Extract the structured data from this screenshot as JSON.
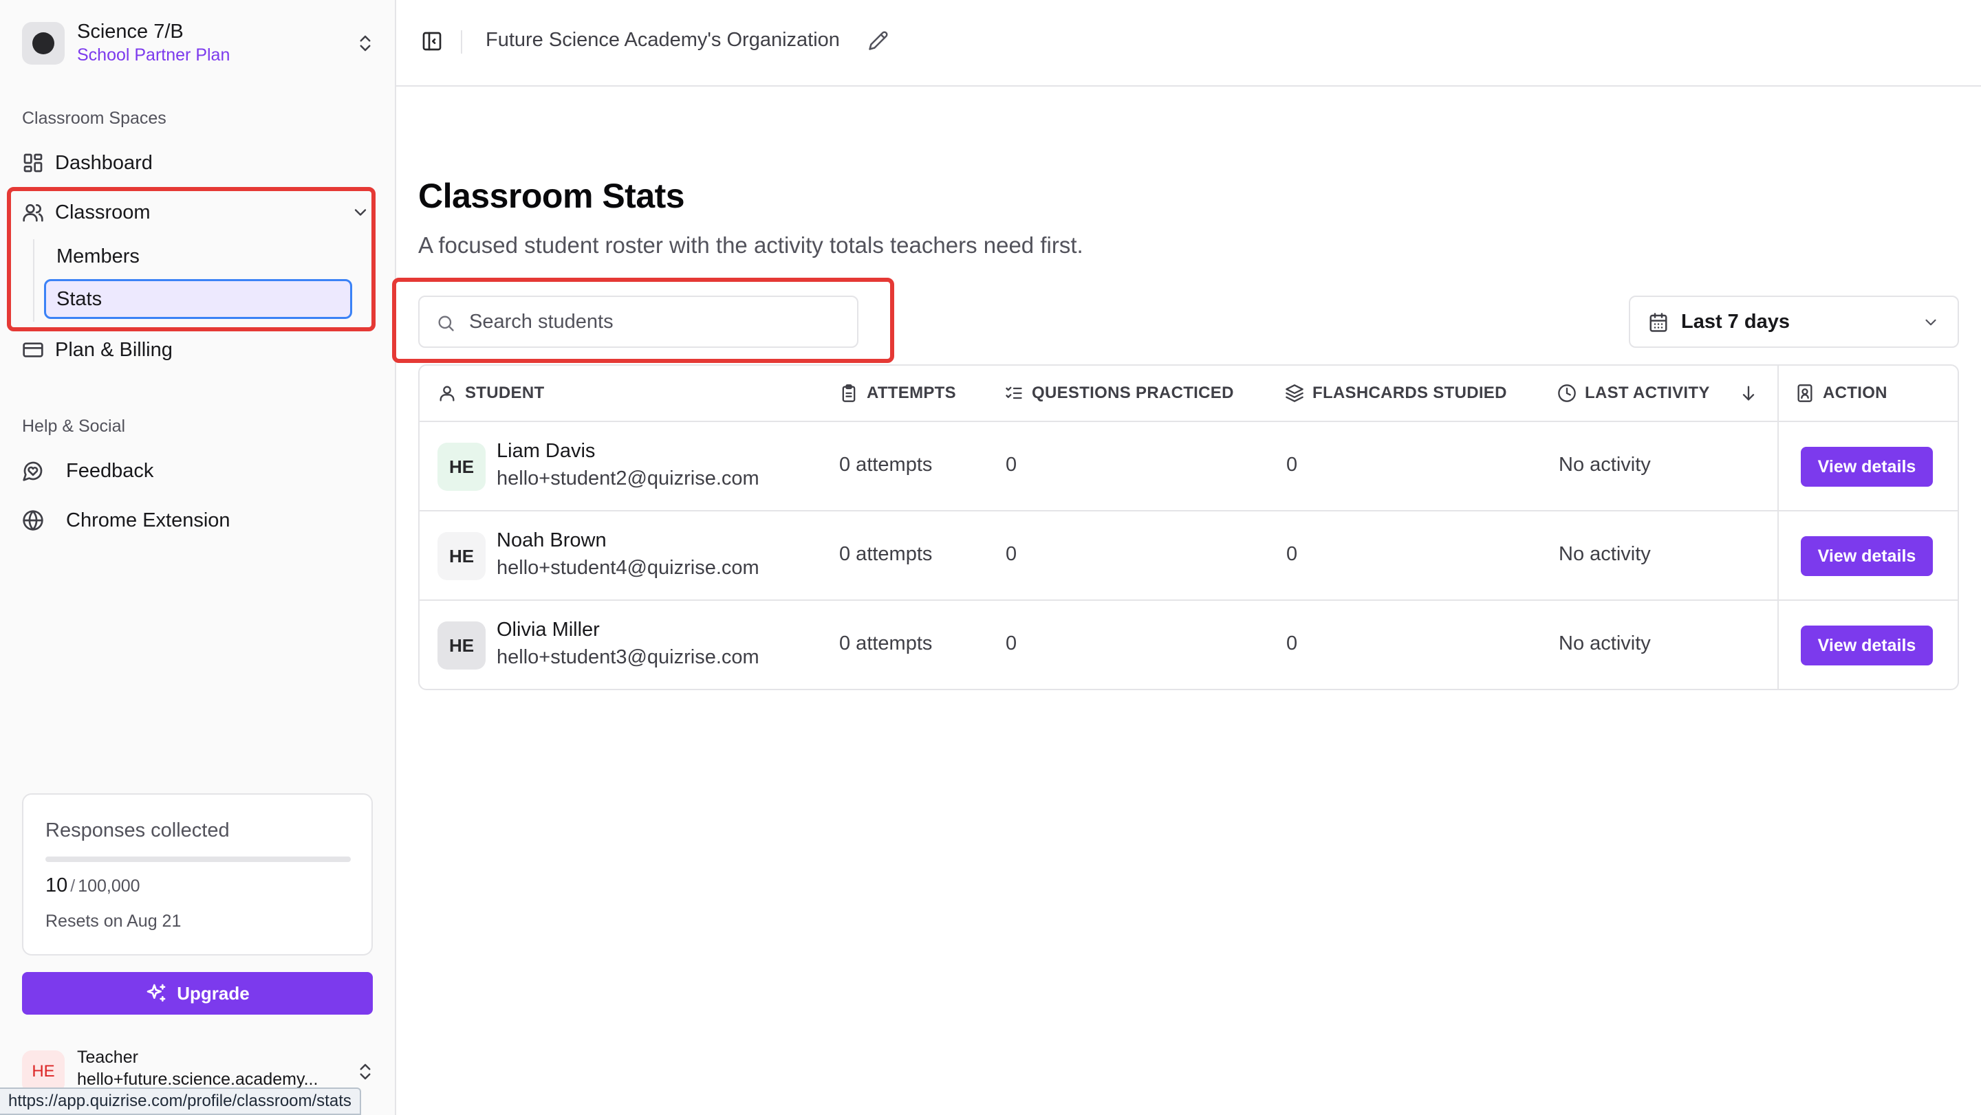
{
  "workspace": {
    "name": "Science 7/B",
    "plan": "School Partner Plan"
  },
  "sidebar": {
    "section_spaces": "Classroom Spaces",
    "dashboard": "Dashboard",
    "classroom": "Classroom",
    "members": "Members",
    "stats": "Stats",
    "billing": "Plan & Billing",
    "section_help": "Help & Social",
    "feedback": "Feedback",
    "extension": "Chrome Extension"
  },
  "usage": {
    "title": "Responses collected",
    "used": "10",
    "separator": "/",
    "limit": "100,000",
    "fill_fraction": 0.0001,
    "reset": "Resets on Aug 21"
  },
  "upgrade_label": "Upgrade",
  "user": {
    "initials": "HE",
    "role": "Teacher",
    "email": "hello+future.science.academy..."
  },
  "status_url": "https://app.quizrise.com/profile/classroom/stats",
  "header": {
    "org_name": "Future Science Academy's Organization"
  },
  "main": {
    "title": "Classroom Stats",
    "subtitle": "A focused student roster with the activity totals teachers need first.",
    "search_placeholder": "Search students",
    "range": "Last 7 days"
  },
  "table": {
    "columns": {
      "student": "STUDENT",
      "attempts": "ATTEMPTS",
      "questions": "QUESTIONS PRACTICED",
      "flashcards": "FLASHCARDS STUDIED",
      "last_activity": "LAST ACTIVITY",
      "action": "ACTION"
    },
    "rows": [
      {
        "initials": "HE",
        "name": "Liam Davis",
        "email": "hello+student2@quizrise.com",
        "attempts": "0 attempts",
        "questions": "0",
        "flashcards": "0",
        "last_activity": "No activity",
        "action": "View details",
        "avatar_bg": "#e7f6ec"
      },
      {
        "initials": "HE",
        "name": "Noah Brown",
        "email": "hello+student4@quizrise.com",
        "attempts": "0 attempts",
        "questions": "0",
        "flashcards": "0",
        "last_activity": "No activity",
        "action": "View details",
        "avatar_bg": "#f4f4f5"
      },
      {
        "initials": "HE",
        "name": "Olivia Miller",
        "email": "hello+student3@quizrise.com",
        "attempts": "0 attempts",
        "questions": "0",
        "flashcards": "0",
        "last_activity": "No activity",
        "action": "View details",
        "avatar_bg": "#e4e4e7"
      }
    ]
  },
  "colors": {
    "accent": "#7c3aed",
    "highlight": "#e53935",
    "active_bg": "#ede9fe",
    "active_border": "#3b82f6"
  }
}
